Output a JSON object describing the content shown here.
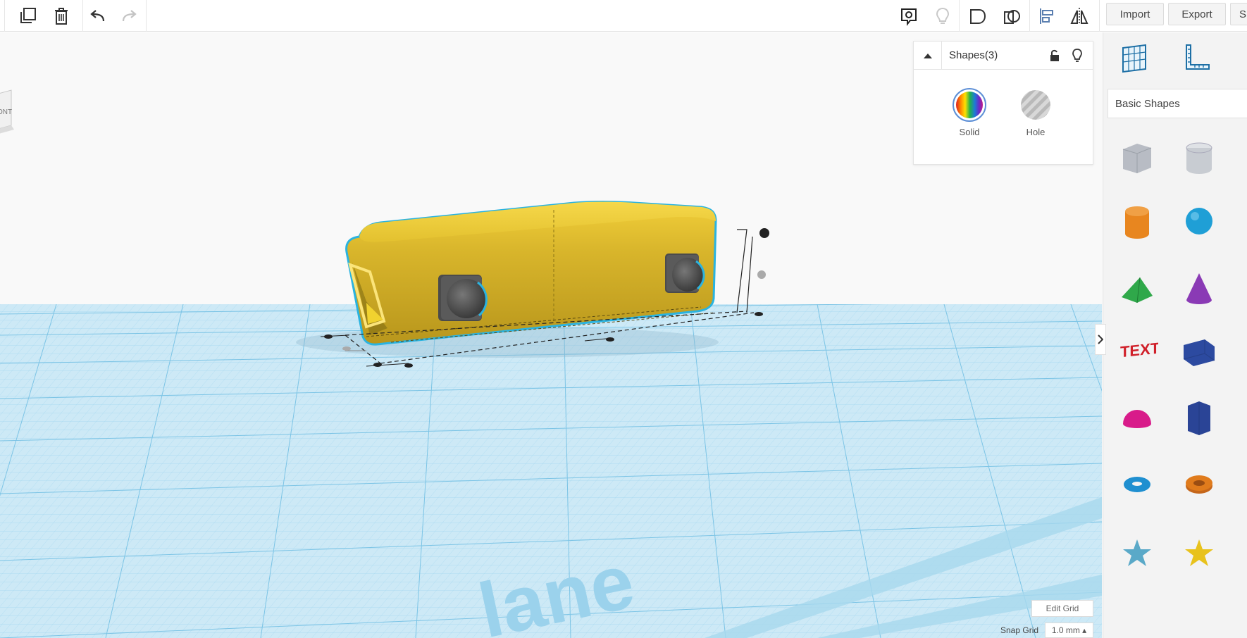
{
  "toolbar": {
    "buttons": [
      {
        "id": "copy",
        "icon": "copy-icon"
      },
      {
        "id": "delete",
        "icon": "trash-icon"
      },
      {
        "id": "undo",
        "icon": "undo-icon"
      },
      {
        "id": "redo",
        "icon": "redo-icon",
        "disabled": true
      }
    ],
    "right_icons": [
      "notes-icon",
      "lightbulb-icon",
      "group-icon",
      "ungroup-icon",
      "align-icon",
      "mirror-icon"
    ],
    "import_label": "Import",
    "export_label": "Export",
    "send_label": "S"
  },
  "view_cube": {
    "face_label": "ONT"
  },
  "inspector": {
    "title": "Shapes(3)",
    "solid_label": "Solid",
    "hole_label": "Hole"
  },
  "library": {
    "category": "Basic Shapes",
    "shapes": [
      {
        "name": "box-hole",
        "color": "#b8bcc4"
      },
      {
        "name": "cylinder-hole",
        "color": "#c8ccd2"
      },
      {
        "name": "cylinder",
        "color": "#e8861f"
      },
      {
        "name": "sphere",
        "color": "#1f9fd6"
      },
      {
        "name": "roof",
        "color": "#2fa84a"
      },
      {
        "name": "cone",
        "color": "#8a3ab5"
      },
      {
        "name": "text",
        "color": "#d0202a"
      },
      {
        "name": "box",
        "color": "#2c4aa0"
      },
      {
        "name": "half-sphere",
        "color": "#d81b8a"
      },
      {
        "name": "polygon",
        "color": "#2a4496"
      },
      {
        "name": "torus",
        "color": "#1f8fd0"
      },
      {
        "name": "tube",
        "color": "#e07b1c"
      },
      {
        "name": "star-blue",
        "color": "#5aa9c8"
      },
      {
        "name": "star-yellow",
        "color": "#e8c21c"
      }
    ]
  },
  "grid": {
    "edit_label": "Edit Grid",
    "snap_label": "Snap Grid",
    "snap_value": "1.0 mm ▴"
  },
  "workplane_text": "lane",
  "colors": {
    "accent": "#2ab3e0",
    "object": "#d6b52a",
    "grid": "#7fc6e6"
  }
}
